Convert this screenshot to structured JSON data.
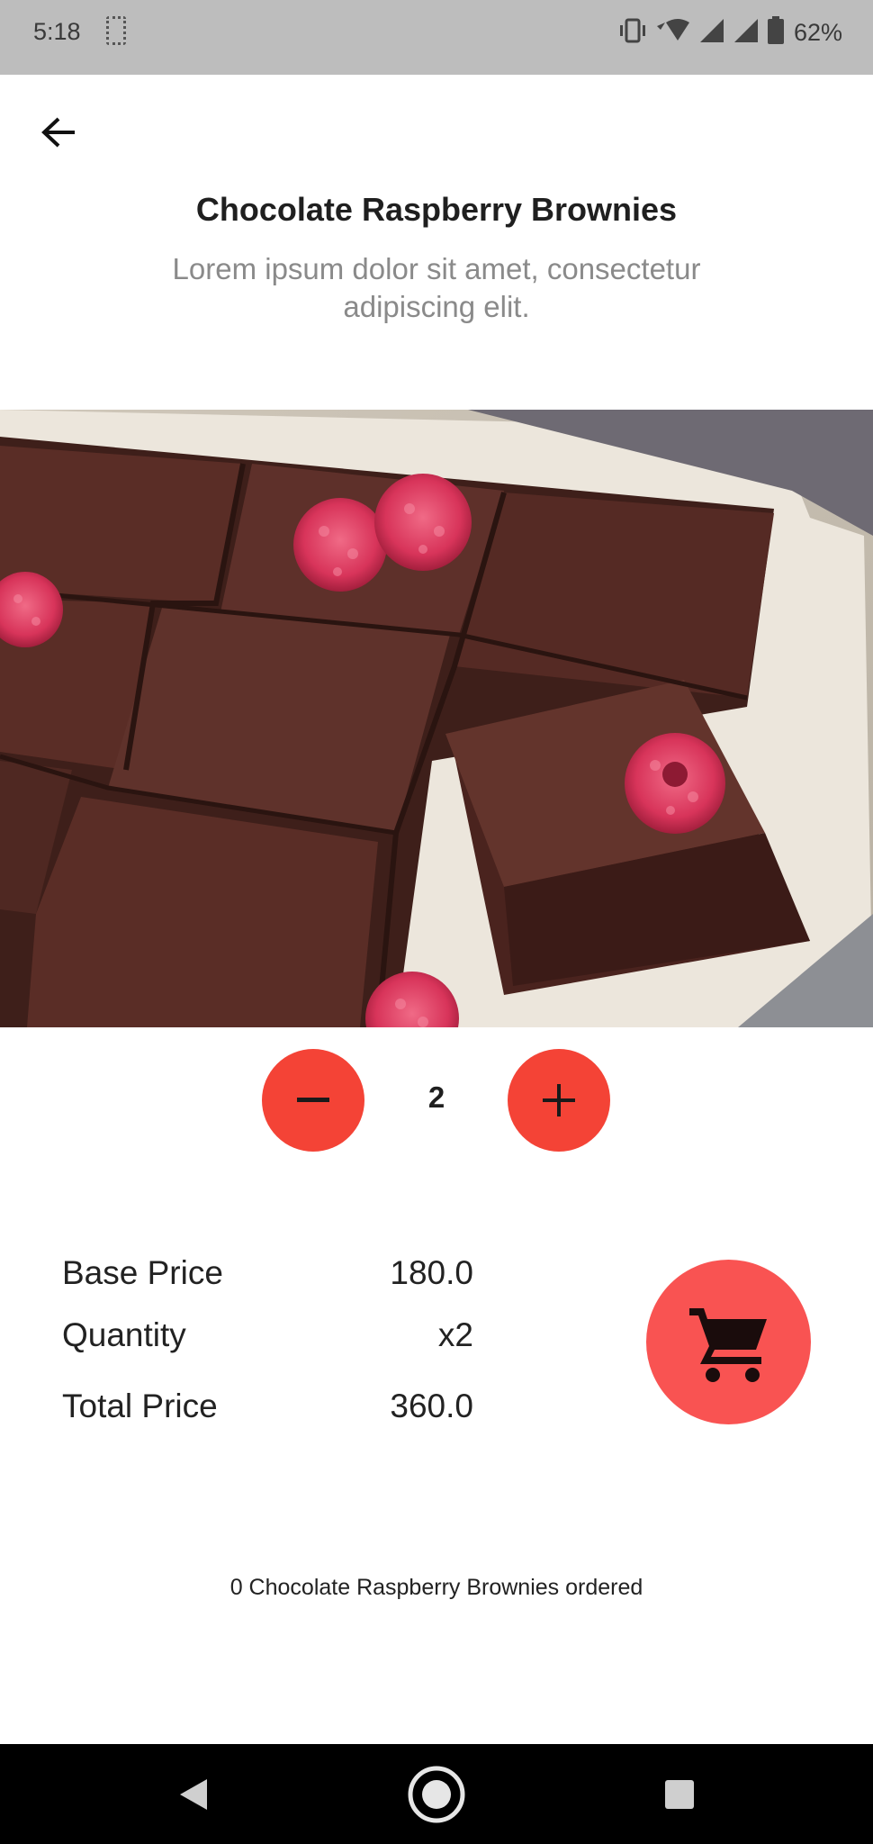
{
  "status_bar": {
    "time": "5:18",
    "battery_percent": "62%",
    "icons": [
      "sim-card-icon",
      "vibrate-icon",
      "wifi-icon",
      "signal-icon",
      "signal-icon",
      "battery-icon"
    ]
  },
  "header": {
    "back_icon": "arrow-left-icon",
    "title": "Chocolate Raspberry Brownies",
    "subtitle": "Lorem ipsum dolor sit amet, consectetur adipiscing elit."
  },
  "hero_image": {
    "subject": "brownies-with-raspberries"
  },
  "stepper": {
    "decrement_icon": "minus-icon",
    "quantity": "2",
    "increment_icon": "plus-icon",
    "color": "#f44336"
  },
  "pricing": {
    "base_price_label": "Base Price",
    "base_price_value": "180.0",
    "quantity_label": "Quantity",
    "quantity_value": "x2",
    "total_price_label": "Total Price",
    "total_price_value": "360.0"
  },
  "cart": {
    "icon": "shopping-cart-icon",
    "color": "#f95352"
  },
  "order_status": "0 Chocolate Raspberry Brownies ordered",
  "nav_bar": {
    "buttons": [
      "back-triangle-icon",
      "home-circle-icon",
      "recents-square-icon"
    ]
  }
}
